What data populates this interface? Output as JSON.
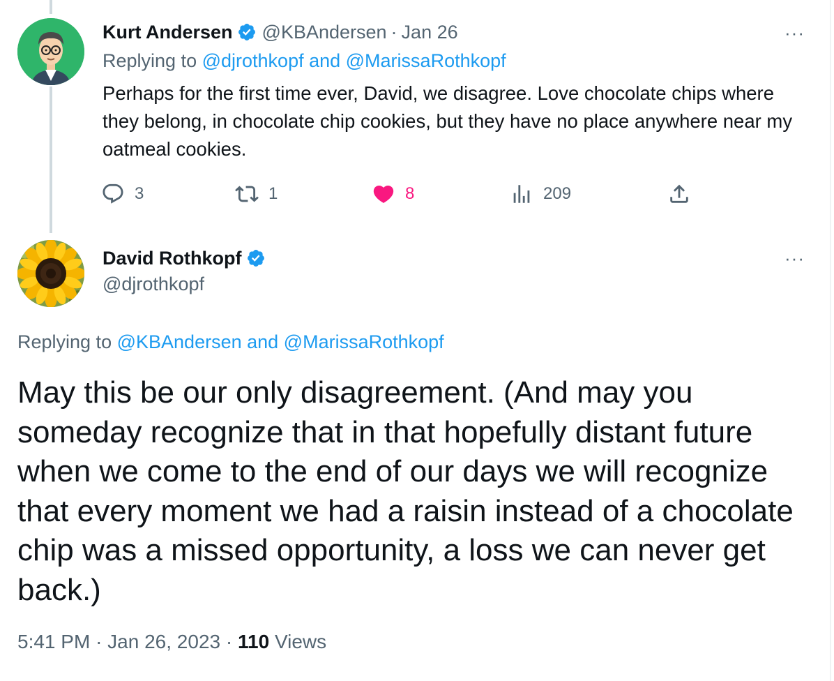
{
  "tweet1": {
    "author_name": "Kurt Andersen",
    "handle": "@KBAndersen",
    "separator": "·",
    "date": "Jan 26",
    "replying_prefix": "Replying to",
    "replying_to": "@djrothkopf and @MarissaRothkopf",
    "text": "Perhaps for the first time ever, David, we disagree. Love chocolate chips where they belong, in chocolate chip cookies, but they have no place anywhere near my oatmeal cookies.",
    "stats": {
      "replies": "3",
      "retweets": "1",
      "likes": "8",
      "views": "209"
    },
    "more": "···"
  },
  "tweet2": {
    "author_name": "David Rothkopf",
    "handle": "@djrothkopf",
    "replying_prefix": "Replying to",
    "replying_to": "@KBAndersen and @MarissaRothkopf",
    "text": "May this be our only disagreement. (And may you someday recognize that in that hopefully distant future when we come to the end of our days we will recognize that every moment we had a raisin instead of a chocolate chip was a missed opportunity, a loss we can never get back.)",
    "time": "5:41 PM",
    "separator": "·",
    "date": "Jan 26, 2023",
    "views_count": "110",
    "views_label": "Views",
    "more": "···"
  },
  "colors": {
    "link": "#1d9bf0",
    "muted": "#536471",
    "like": "#f91880",
    "verified": "#1d9bf0"
  },
  "icons": {
    "reply": "reply-icon",
    "retweet": "retweet-icon",
    "like": "heart-icon",
    "views": "views-icon",
    "share": "share-icon",
    "verified": "verified-badge-icon"
  }
}
